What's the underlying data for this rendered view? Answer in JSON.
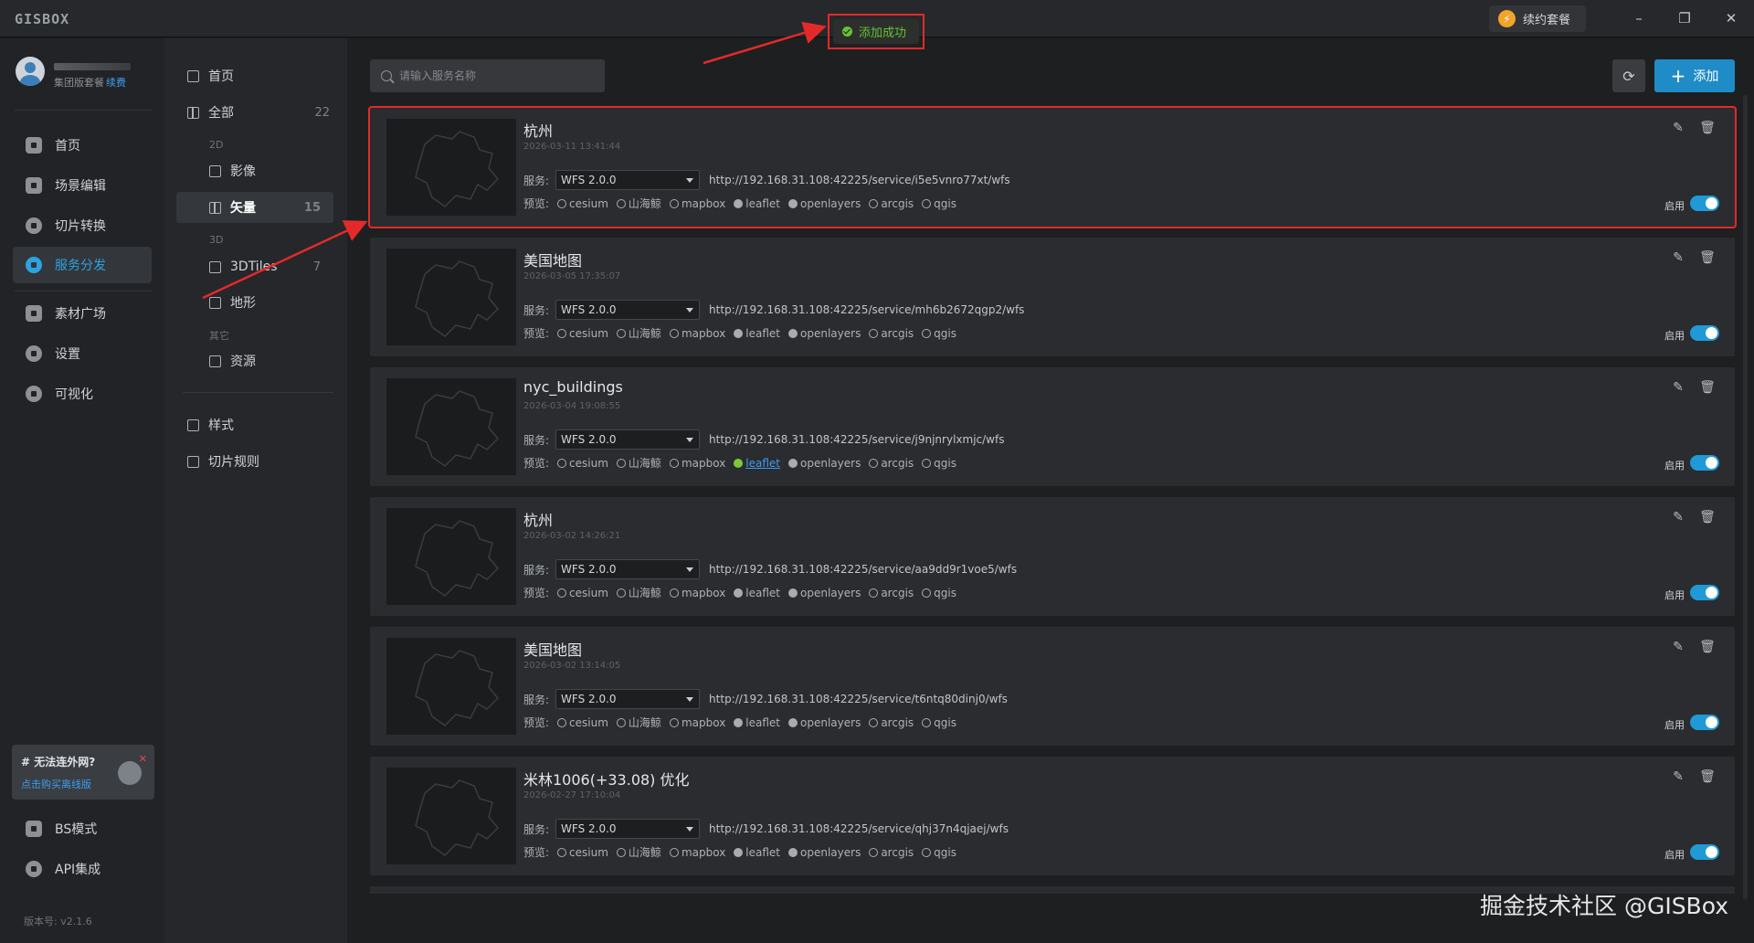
{
  "app": {
    "logo": "GISBOX"
  },
  "titlebar": {
    "renew_label": "续约套餐",
    "minimize": "–",
    "maximize": "❐",
    "close": "✕"
  },
  "toast": {
    "text": "添加成功"
  },
  "user": {
    "plan": "集团版套餐",
    "renew": "续费"
  },
  "leftnav": {
    "items": [
      {
        "label": "首页",
        "icon": "home-icon"
      },
      {
        "label": "场景编辑",
        "icon": "cube-icon"
      },
      {
        "label": "切片转换",
        "icon": "convert-icon"
      },
      {
        "label": "服务分发",
        "icon": "upload-icon"
      },
      {
        "label": "素材广场",
        "icon": "image-icon"
      },
      {
        "label": "设置",
        "icon": "gear-icon"
      },
      {
        "label": "可视化",
        "icon": "chart-icon"
      }
    ],
    "promo_title": "# 无法连外网?",
    "promo_link": "点击购买离线版",
    "bottom_items": [
      {
        "label": "BS模式",
        "icon": "code-icon"
      },
      {
        "label": "API集成",
        "icon": "api-icon"
      }
    ],
    "version": "版本号: v2.1.6"
  },
  "subnav": {
    "home": "首页",
    "all": "全部",
    "all_count": "22",
    "group_2d": "2D",
    "imagery": "影像",
    "vector": "矢量",
    "vector_count": "15",
    "group_3d": "3D",
    "tiles3d": "3DTiles",
    "tiles3d_count": "7",
    "terrain": "地形",
    "group_other": "其它",
    "resource": "资源",
    "style": "样式",
    "tile_rules": "切片规则"
  },
  "toolbar": {
    "search_placeholder": "请输入服务名称",
    "refresh_icon": "⟳",
    "add_plus": "+",
    "add_label": "添加"
  },
  "labels": {
    "service": "服务:",
    "preview": "预览:",
    "enable": "启用",
    "edit_icon": "✎",
    "delete_icon": "🗑"
  },
  "services": [
    {
      "name": "杭州",
      "time": "2026-03-11 13:41:44",
      "version": "WFS 2.0.0",
      "url": "http://192.168.31.108:42225/service/i5e5vnro77xt/wfs",
      "enabled": true
    },
    {
      "name": "美国地图",
      "time": "2026-03-05 17:35:07",
      "version": "WFS 2.0.0",
      "url": "http://192.168.31.108:42225/service/mh6b2672qgp2/wfs",
      "enabled": true
    },
    {
      "name": "nyc_buildings",
      "time": "2026-03-04 19:08:55",
      "version": "WFS 2.0.0",
      "url": "http://192.168.31.108:42225/service/j9njnrylxmjc/wfs",
      "enabled": true
    },
    {
      "name": "杭州",
      "time": "2026-03-02 14:26:21",
      "version": "WFS 2.0.0",
      "url": "http://192.168.31.108:42225/service/aa9dd9r1voe5/wfs",
      "enabled": true
    },
    {
      "name": "美国地图",
      "time": "2026-03-02 13:14:05",
      "version": "WFS 2.0.0",
      "url": "http://192.168.31.108:42225/service/t6ntq80dinj0/wfs",
      "enabled": true
    },
    {
      "name": "米林1006(+33.08) 优化",
      "time": "2026-02-27 17:10:04",
      "version": "WFS 2.0.0",
      "url": "http://192.168.31.108:42225/service/qhj37n4qjaej/wfs",
      "enabled": true
    }
  ],
  "preview_libs": [
    "cesium",
    "山海鲸",
    "mapbox",
    "leaflet",
    "openlayers",
    "arcgis",
    "qgis"
  ],
  "watermark": "掘金技术社区 @GISBox",
  "colors": {
    "accent": "#1f8bc7",
    "success": "#67c23a",
    "annotation_red": "#e32a2a"
  }
}
